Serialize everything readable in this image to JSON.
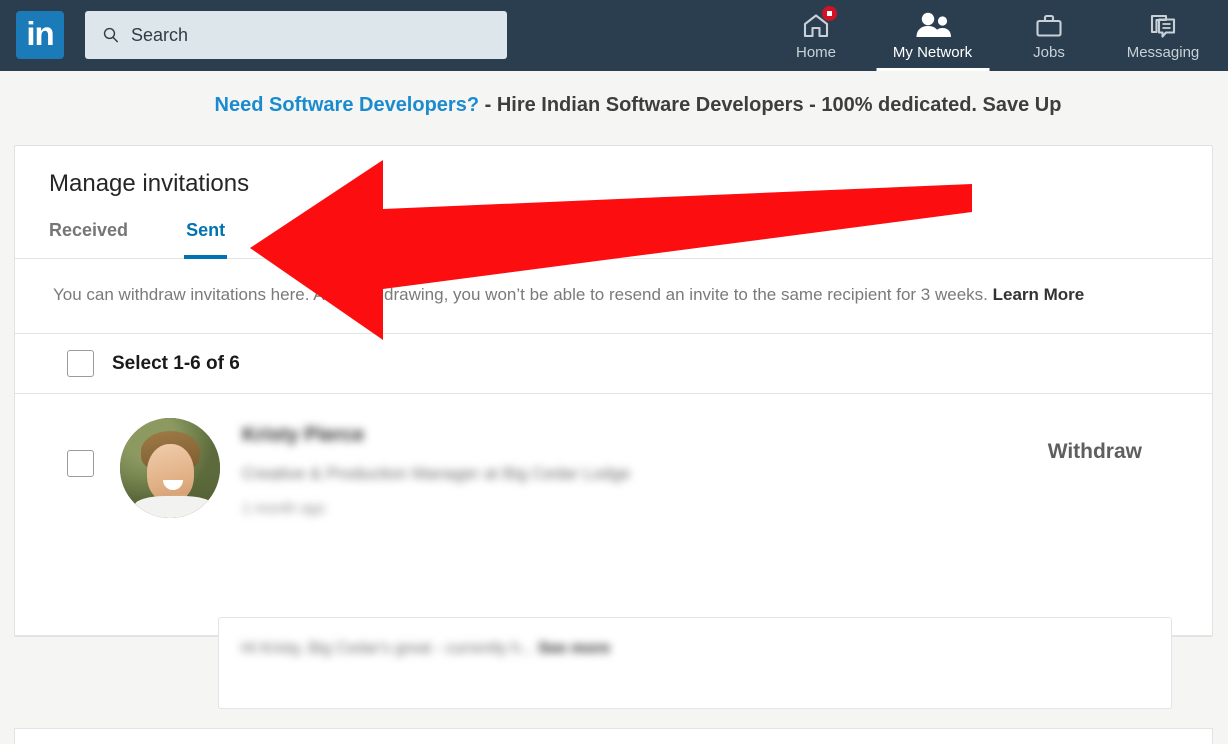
{
  "topbar": {
    "logo_text": "in",
    "logo_icon": "linkedin-logo-icon",
    "search": {
      "icon": "search-icon",
      "placeholder": "Search",
      "value": "Search"
    },
    "nav": [
      {
        "label": "Home",
        "icon": "home-icon",
        "active": false,
        "badge": true
      },
      {
        "label": "My Network",
        "icon": "my-network-icon",
        "active": true,
        "badge": false
      },
      {
        "label": "Jobs",
        "icon": "briefcase-icon",
        "active": false,
        "badge": false
      },
      {
        "label": "Messaging",
        "icon": "messaging-icon",
        "active": false,
        "badge": false
      }
    ]
  },
  "banner": {
    "highlight": "Need Software Developers?",
    "rest": " - Hire Indian Software Developers - 100% dedicated. Save Up"
  },
  "card": {
    "title": "Manage invitations",
    "tabs": [
      {
        "label": "Received",
        "active": false
      },
      {
        "label": "Sent",
        "active": true
      }
    ],
    "note": {
      "text": "You can withdraw invitations here. After withdrawing, you won’t be able to resend an invite to the same recipient for 3 weeks. ",
      "link": "Learn More"
    },
    "select_all": {
      "label": "Select 1-6 of 6",
      "checked": false
    },
    "invitations": [
      {
        "name": "Kristy Pierce",
        "headline": "Creative & Production Manager at Big Cedar Lodge",
        "time": "1 month ago",
        "action": "Withdraw",
        "checked": false,
        "message": "Hi Kristy, Big Cedar's great - currently h...",
        "message_more": "See more"
      }
    ]
  },
  "annotation": {
    "arrow_color": "#fc0d10",
    "points_at": "Sent"
  },
  "colors": {
    "nav_background": "#2b3e50",
    "brand_blue": "#0073b1",
    "page_background": "#f5f5f3",
    "accent_red": "#fc0d10"
  }
}
